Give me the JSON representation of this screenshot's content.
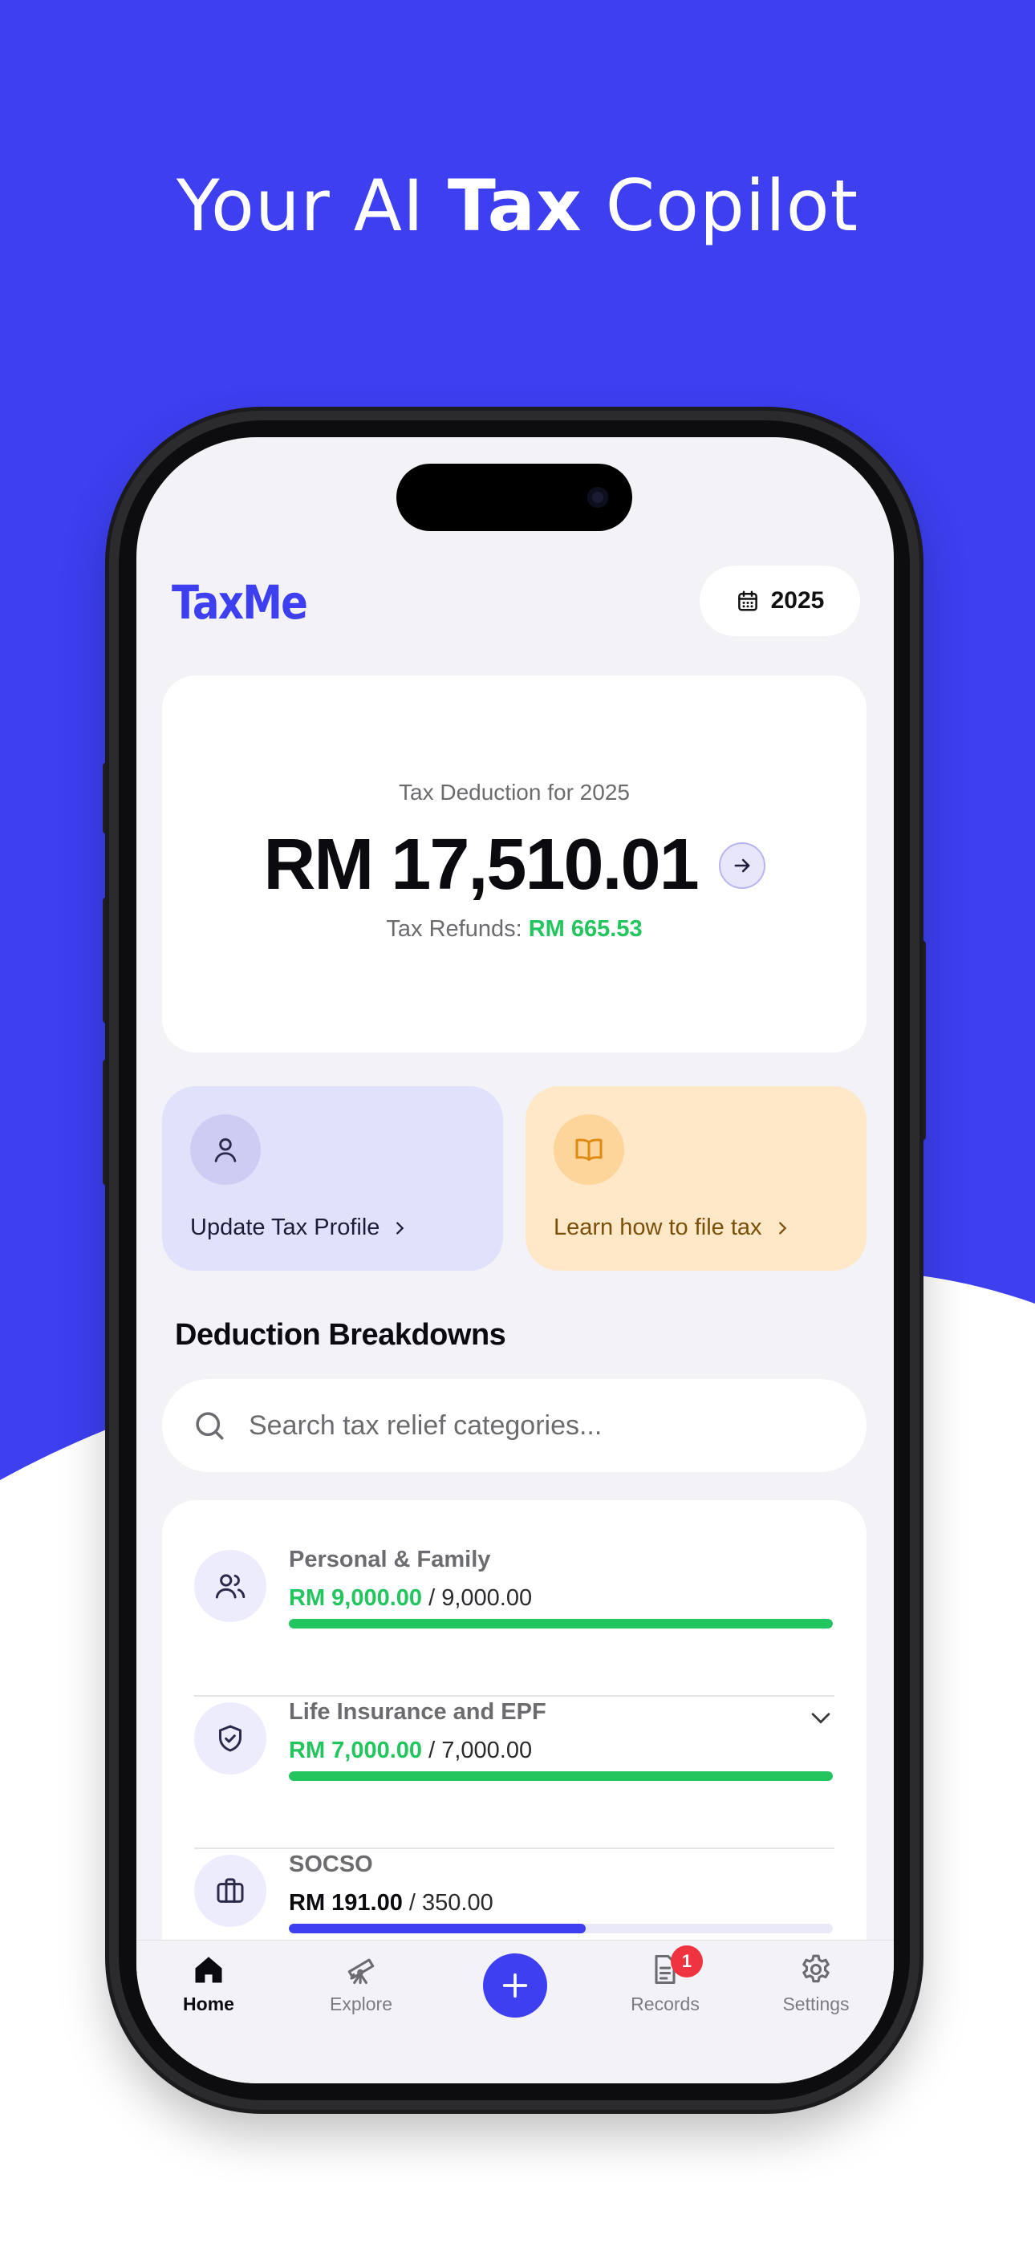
{
  "colors": {
    "brand": "#3d3ff0",
    "green": "#22c55e",
    "badge": "#ef3340"
  },
  "headline": {
    "part1": "Your AI ",
    "bold": "Tax",
    "part2": " Copilot"
  },
  "header": {
    "logo": "TaxMe",
    "year": "2025",
    "year_icon": "calendar-icon"
  },
  "summary": {
    "label": "Tax Deduction for 2025",
    "amount": "RM 17,510.01",
    "arrow_icon": "arrow-right-icon",
    "refund_label": "Tax Refunds: ",
    "refund_value": "RM 665.53"
  },
  "actions": [
    {
      "label": "Update Tax Profile",
      "icon": "user-icon"
    },
    {
      "label": "Learn how to file tax",
      "icon": "book-open-icon"
    }
  ],
  "section_title": "Deduction Breakdowns",
  "search": {
    "placeholder": "Search tax relief categories..."
  },
  "breakdowns": [
    {
      "name": "Personal & Family",
      "current": "RM 9,000.00",
      "limit": " / 9,000.00",
      "progress": 1.0,
      "icon": "users-icon"
    },
    {
      "name": "Life Insurance and EPF",
      "current": "RM 7,000.00",
      "limit": " / 7,000.00",
      "progress": 1.0,
      "icon": "shield-check-icon",
      "expand_icon": "chevron-down-icon"
    },
    {
      "name": "SOCSO",
      "current": "RM 191.00",
      "limit": " / 350.00",
      "progress": 0.546,
      "icon": "briefcase-icon"
    }
  ],
  "tabs": [
    {
      "label": "Home",
      "icon": "home-icon",
      "active": true
    },
    {
      "label": "Explore",
      "icon": "telescope-icon"
    },
    {
      "label": "",
      "icon": "plus-icon"
    },
    {
      "label": "Records",
      "icon": "document-icon",
      "badge": "1"
    },
    {
      "label": "Settings",
      "icon": "gear-icon"
    }
  ]
}
